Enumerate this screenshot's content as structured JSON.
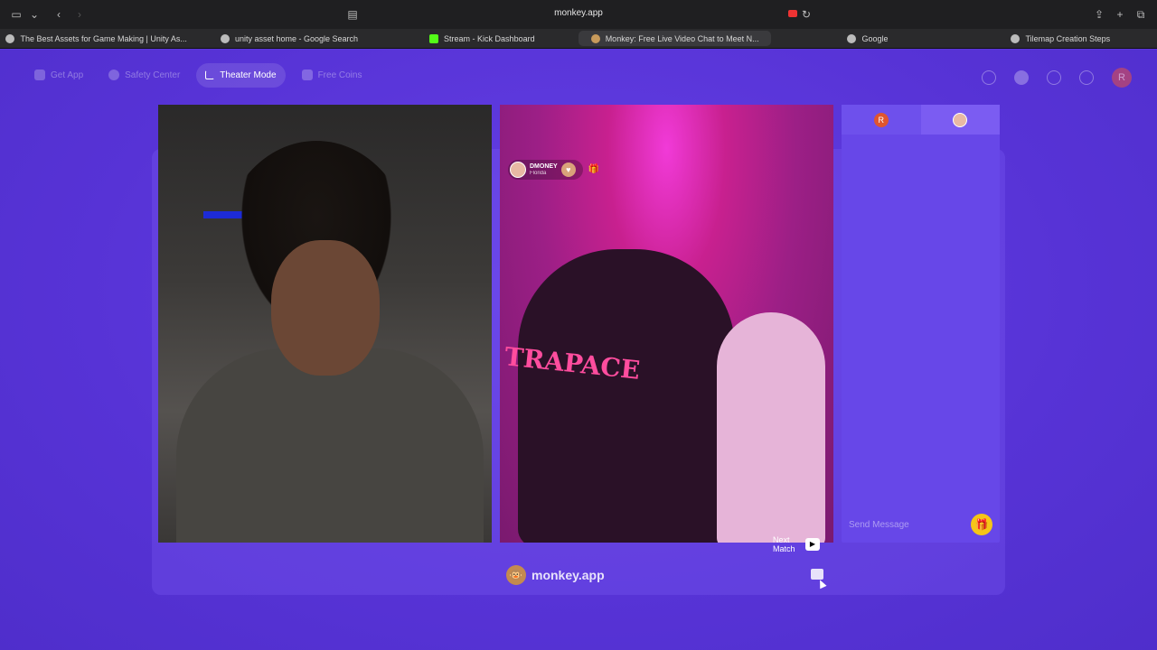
{
  "browser": {
    "url": "monkey.app",
    "tabs": [
      {
        "label": "The Best Assets for Game Making | Unity As...",
        "icon": "unity-icon"
      },
      {
        "label": "unity asset home - Google Search",
        "icon": "google-icon"
      },
      {
        "label": "Stream - Kick Dashboard",
        "icon": "kick-icon"
      },
      {
        "label": "Monkey: Free Live Video Chat to Meet N...",
        "icon": "monkey-icon",
        "active": true
      },
      {
        "label": "Google",
        "icon": "google-icon"
      },
      {
        "label": "Tilemap Creation Steps",
        "icon": "chatgpt-icon"
      }
    ]
  },
  "nav": {
    "get_app": "Get App",
    "safety_center": "Safety Center",
    "theater_mode": "Theater Mode",
    "free_coins": "Free Coins",
    "profile_initial": "R"
  },
  "remote_user": {
    "name": "DMONEY",
    "location": "Florida"
  },
  "video": {
    "shirt_text": "TRAPACE",
    "watermark": "monkey.app",
    "next_match": "Next Match"
  },
  "chat": {
    "self_initial": "R",
    "placeholder": "Send Message"
  },
  "colors": {
    "accent": "#5a35d8",
    "gift": "#f5c518"
  }
}
